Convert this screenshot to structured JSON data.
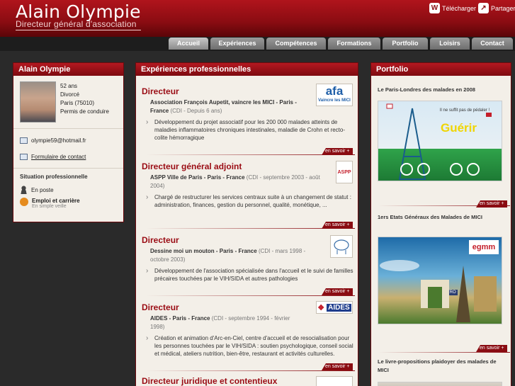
{
  "header": {
    "name": "Alain Olympie",
    "subtitle": "Directeur général d'association",
    "actions": [
      {
        "label": "Télécharger",
        "icon": "download-icon"
      },
      {
        "label": "Partager",
        "icon": "share-icon"
      }
    ]
  },
  "nav": {
    "tabs": [
      {
        "label": "Accueil",
        "active": true
      },
      {
        "label": "Expériences",
        "active": false
      },
      {
        "label": "Compétences",
        "active": false
      },
      {
        "label": "Formations",
        "active": false
      },
      {
        "label": "Portfolio",
        "active": false
      },
      {
        "label": "Loisirs",
        "active": false
      },
      {
        "label": "Contact",
        "active": false
      }
    ]
  },
  "profile": {
    "title": "Alain Olympie",
    "facts": [
      "52 ans",
      "Divorcé",
      "Paris (75010)",
      "Permis de conduire"
    ],
    "email": "olympie59@hotmail.fr",
    "contact_form": "Formulaire de contact",
    "situation_title": "Situation professionnelle",
    "situation": [
      {
        "label": "En poste",
        "sub": "",
        "icon": "person-icon"
      },
      {
        "label": "Emploi et carrière",
        "sub": "En simple veille",
        "icon": "career-icon"
      }
    ]
  },
  "experiences": {
    "title": "Expériences professionnelles",
    "more_label": "en savoir +",
    "items": [
      {
        "title": "Directeur",
        "org": "Association François Aupetit, vaincre les MICI - Paris - France",
        "dates": "(CDI - Depuis 6 ans)",
        "desc": "Développement du projet associatif pour les 200 000 malades atteints de maladies inflammatoires chroniques intestinales, maladie de Crohn et recto-colite hémorragique",
        "logo_text": "afa",
        "logo_sub": "Vaincre les MICI"
      },
      {
        "title": "Directeur général adjoint",
        "org": "ASPP Ville de Paris - Paris - France",
        "dates": "(CDI - septembre 2003 - août 2004)",
        "desc": "Chargé de restructurer les services centraux suite à un changement de statut : administration, finances, gestion du personnel, qualité, monétique, ...",
        "logo_text": "ASPP",
        "logo_sub": ""
      },
      {
        "title": "Directeur",
        "org": "Dessine moi un mouton - Paris - France",
        "dates": "(CDI - mars 1998 - octobre 2003)",
        "desc": "Développement de l'association spécialisée dans l'accueil et le suivi de familles précaires touchées par le VIH/SIDA et autres pathologies",
        "logo_text": "",
        "logo_sub": ""
      },
      {
        "title": "Directeur",
        "org": "AIDES - Paris - France",
        "dates": "(CDI - septembre 1994 - février 1998)",
        "desc": "Création et animation d'Arc-en-Ciel, centre d'accueil et de resocialisation pour les personnes touchées par le VIH/SIDA : soutien psychologique, conseil social et médical, ateliers nutrition, bien-être, restaurant et activités culturelles.",
        "logo_text": "AIDES",
        "logo_sub": ""
      },
      {
        "title": "Directeur juridique et contentieux",
        "org": "",
        "dates": "",
        "desc": "",
        "logo_text": "",
        "logo_sub": ""
      }
    ]
  },
  "portfolio": {
    "title": "Portfolio",
    "more_label": "en savoir +",
    "items": [
      {
        "title": "Le Paris-Londres des malades en 2008",
        "image_text": "Guérir",
        "image_caption": "Il ne suffit pas de pédaler !"
      },
      {
        "title": "1ers Etats Généraux des Malades de MICI",
        "image_text": "egmm",
        "image_caption": "MÉTRO"
      },
      {
        "title": "Le livre-propositions plaidoyer des malades de MICI",
        "image_text": "",
        "image_caption": ""
      }
    ]
  },
  "colors": {
    "brand": "#8a0c12",
    "accent": "#b0141c",
    "panel": "#f3efe8"
  }
}
